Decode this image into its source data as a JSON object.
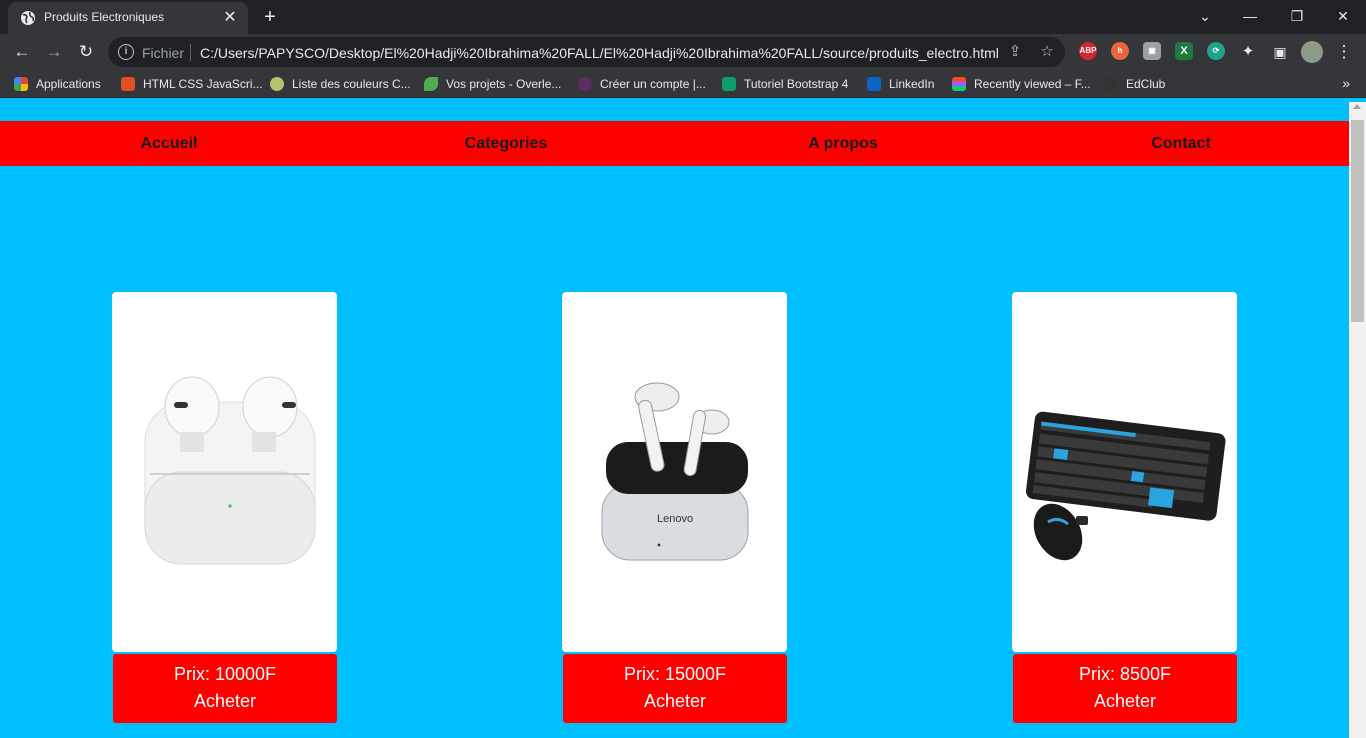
{
  "browser": {
    "tab_title": "Produits Electroniques",
    "tab_close": "✕",
    "new_tab": "+",
    "address_scheme": "Fichier",
    "address_url": "C:/Users/PAPYSCO/Desktop/El%20Hadji%20Ibrahima%20FALL/El%20Hadji%20Ibrahima%20FALL/source/produits_electro.html",
    "extensions": [
      {
        "name": "adblock-plus",
        "label": "ABP",
        "color": "#d9262e"
      },
      {
        "name": "honey",
        "label": "h",
        "color": "#e8673c"
      },
      {
        "name": "screenshot",
        "label": "",
        "color": "#9aa0a6"
      },
      {
        "name": "excel",
        "label": "X",
        "color": "#1f7a3f"
      },
      {
        "name": "sync",
        "label": "",
        "color": "#1fa38a"
      }
    ],
    "bookmarks": [
      {
        "label": "Applications",
        "color": "#f4b400"
      },
      {
        "label": "HTML CSS JavaScri...",
        "color": "#e44d26"
      },
      {
        "label": "Liste des couleurs C...",
        "color": "#b5c46c"
      },
      {
        "label": "Vos projets - Overle...",
        "color": "#4cae4f"
      },
      {
        "label": "Créer un compte |...",
        "color": "#5c2d61"
      },
      {
        "label": "Tutoriel Bootstrap 4",
        "color": "#0a9e6a"
      },
      {
        "label": "LinkedIn",
        "color": "#0a66c2"
      },
      {
        "label": "Recently viewed – F...",
        "color": "#f24e1e"
      },
      {
        "label": "EdClub",
        "color": "#333333"
      }
    ],
    "bookmarks_more": "»"
  },
  "nav": {
    "links": [
      "Accueil",
      "Categories",
      "A propos",
      "Contact"
    ]
  },
  "products": [
    {
      "image": "airpods-icon",
      "price": "Prix: 10000F",
      "buy": "Acheter"
    },
    {
      "image": "lenovo-earbuds-icon",
      "price": "Prix: 15000F",
      "buy": "Acheter"
    },
    {
      "image": "keyboard-mouse-icon",
      "price": "Prix: 8500F",
      "buy": "Acheter"
    }
  ],
  "colors": {
    "page_background": "#00bfff",
    "nav_background": "#ff0000",
    "price_background": "#ff0000"
  }
}
